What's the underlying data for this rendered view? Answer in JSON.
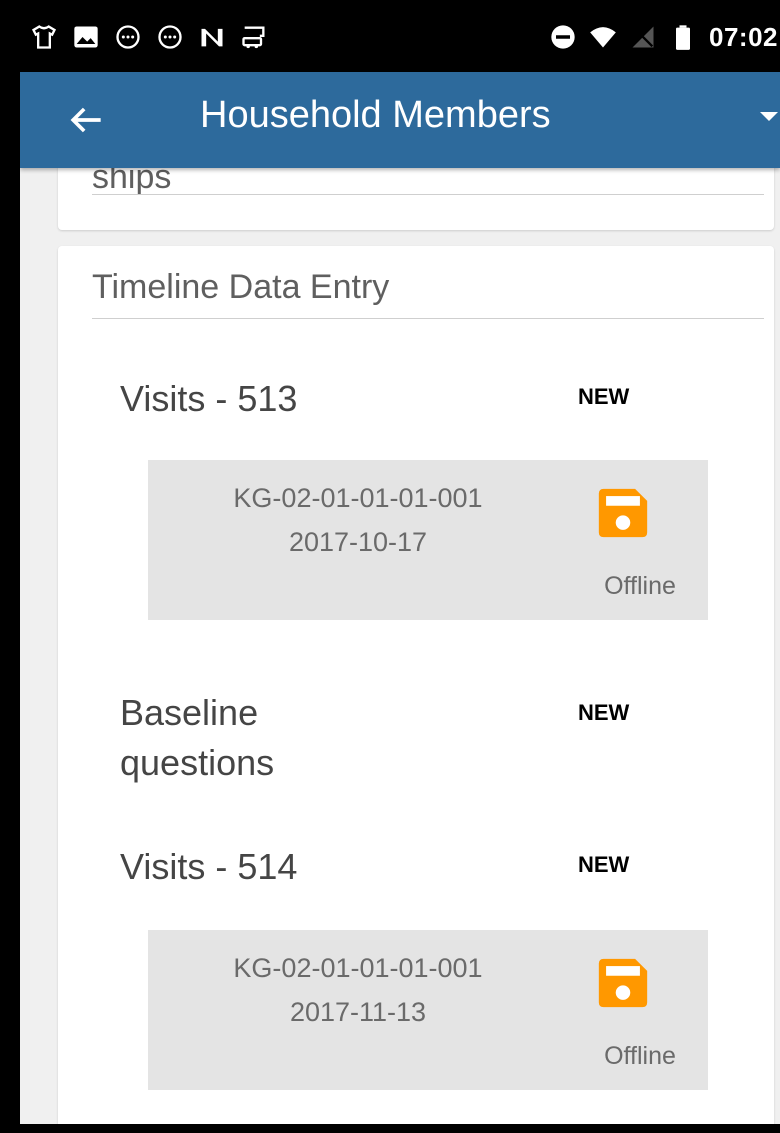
{
  "status_bar": {
    "time": "07:02",
    "left_icons": [
      "tshirt-icon",
      "image-icon",
      "chat-bubble-icon",
      "chat-bubble-icon",
      "n-logo-icon",
      "car-wash-icon"
    ],
    "right_icons": [
      "do-not-disturb-icon",
      "wifi-icon",
      "no-signal-icon",
      "battery-icon"
    ]
  },
  "app_bar": {
    "title": "Household Members",
    "color": "#2d6a9c"
  },
  "top_card": {
    "partial_text": "ships"
  },
  "timeline": {
    "title": "Timeline Data Entry",
    "entries": [
      {
        "title": "Visits - 513",
        "badge": "NEW",
        "record": {
          "id": "KG-02-01-01-01-001",
          "date": "2017-10-17",
          "status": "Offline"
        }
      },
      {
        "title": "Baseline questions",
        "badge": "NEW"
      },
      {
        "title": "Visits - 514",
        "badge": "NEW",
        "record": {
          "id": "KG-02-01-01-01-001",
          "date": "2017-11-13",
          "status": "Offline"
        }
      }
    ]
  },
  "colors": {
    "offline_icon": "#ff9800",
    "record_bg": "#e4e4e4"
  }
}
